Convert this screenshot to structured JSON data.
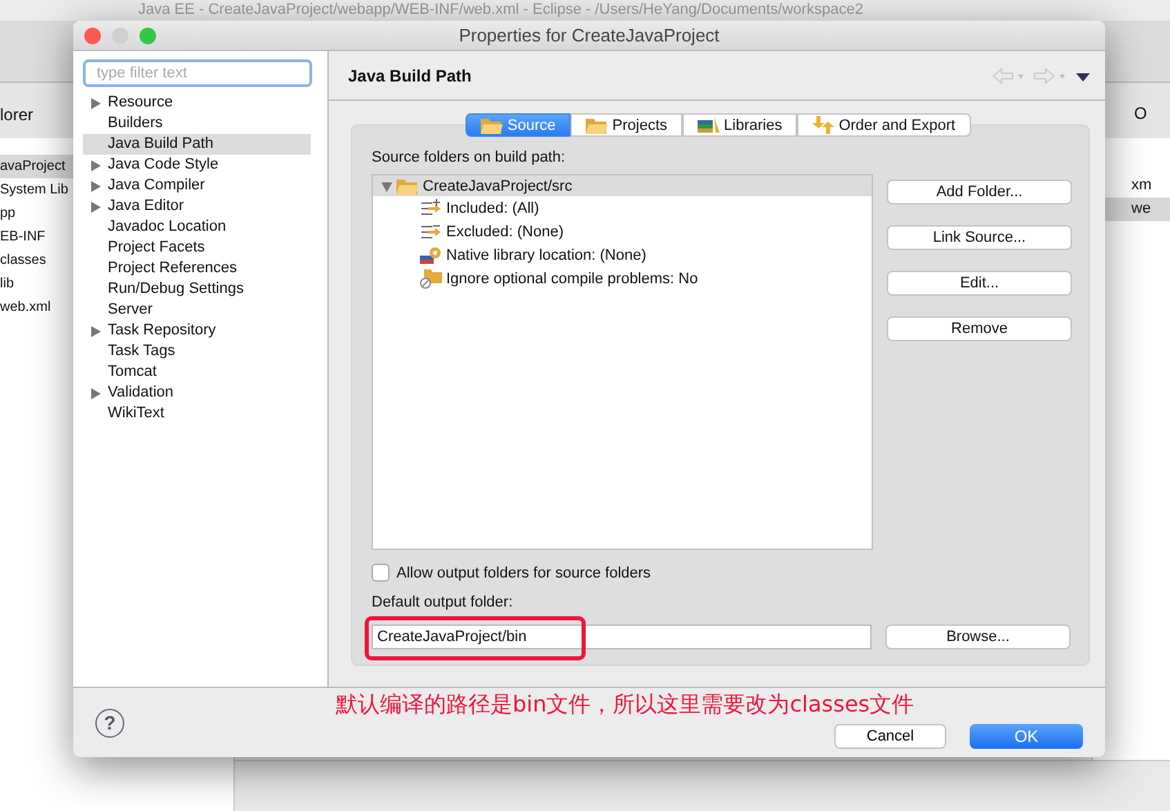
{
  "background": {
    "window_title": "Java EE - CreateJavaProject/webapp/WEB-INF/web.xml - Eclipse - /Users/HeYang/Documents/workspace2",
    "explorer": {
      "tab": "lorer",
      "items": [
        {
          "label": "avaProject",
          "selected": true
        },
        {
          "label": "System Lib",
          "selected": false
        },
        {
          "label": "pp",
          "selected": false
        },
        {
          "label": "EB-INF",
          "selected": false
        },
        {
          "label": "classes",
          "selected": false
        },
        {
          "label": "lib",
          "selected": false
        },
        {
          "label": "web.xml",
          "selected": false
        }
      ]
    },
    "outline": {
      "tab": "O",
      "items": [
        {
          "label": "xm",
          "selected": false
        },
        {
          "label": "we",
          "selected": true
        }
      ]
    }
  },
  "dialog": {
    "title": "Properties for CreateJavaProject",
    "filter": {
      "placeholder": "type filter text"
    },
    "nav": [
      {
        "label": "Resource",
        "expandable": true,
        "selected": false
      },
      {
        "label": "Builders",
        "expandable": false,
        "selected": false
      },
      {
        "label": "Java Build Path",
        "expandable": false,
        "selected": true
      },
      {
        "label": "Java Code Style",
        "expandable": true,
        "selected": false
      },
      {
        "label": "Java Compiler",
        "expandable": true,
        "selected": false
      },
      {
        "label": "Java Editor",
        "expandable": true,
        "selected": false
      },
      {
        "label": "Javadoc Location",
        "expandable": false,
        "selected": false
      },
      {
        "label": "Project Facets",
        "expandable": false,
        "selected": false
      },
      {
        "label": "Project References",
        "expandable": false,
        "selected": false
      },
      {
        "label": "Run/Debug Settings",
        "expandable": false,
        "selected": false
      },
      {
        "label": "Server",
        "expandable": false,
        "selected": false
      },
      {
        "label": "Task Repository",
        "expandable": true,
        "selected": false
      },
      {
        "label": "Task Tags",
        "expandable": false,
        "selected": false
      },
      {
        "label": "Tomcat",
        "expandable": false,
        "selected": false
      },
      {
        "label": "Validation",
        "expandable": true,
        "selected": false
      },
      {
        "label": "WikiText",
        "expandable": false,
        "selected": false
      }
    ],
    "page_title": "Java Build Path",
    "tabs": [
      {
        "label": "Source",
        "kind": "folder",
        "selected": true
      },
      {
        "label": "Projects",
        "kind": "folder",
        "selected": false
      },
      {
        "label": "Libraries",
        "kind": "books",
        "selected": false
      },
      {
        "label": "Order and Export",
        "kind": "arrows",
        "selected": false
      }
    ],
    "source_label": "Source folders on build path:",
    "tree": {
      "label": "CreateJavaProject/src",
      "expanded": true,
      "children": [
        {
          "label": "Included: (All)",
          "kind": "include"
        },
        {
          "label": "Excluded: (None)",
          "kind": "exclude"
        },
        {
          "label": "Native library location: (None)",
          "kind": "native"
        },
        {
          "label": "Ignore optional compile problems: No",
          "kind": "ignore"
        }
      ]
    },
    "side_buttons": [
      "Add Folder...",
      "Link Source...",
      "Edit...",
      "Remove"
    ],
    "allow_output": {
      "label": "Allow output folders for source folders",
      "checked": false
    },
    "output_label": "Default output folder:",
    "output_value": "CreateJavaProject/bin",
    "browse": "Browse...",
    "annotation": "默认编译的路径是bin文件，所以这里需要改为classes文件",
    "help": "?",
    "cancel": "Cancel",
    "ok": "OK"
  }
}
